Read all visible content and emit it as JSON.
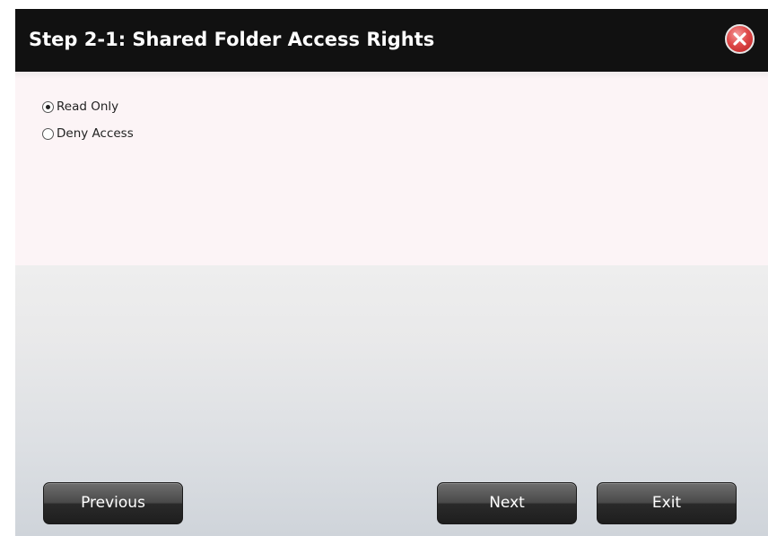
{
  "dialog": {
    "title": "Step 2-1: Shared Folder Access Rights",
    "close_icon": "close-icon"
  },
  "access_options": [
    {
      "label": "Read Only",
      "checked": true
    },
    {
      "label": "Deny Access",
      "checked": false
    }
  ],
  "buttons": {
    "previous": "Previous",
    "next": "Next",
    "exit": "Exit"
  },
  "colors": {
    "titlebar": "#111111",
    "content_bg": "#fcf4f6",
    "close_red": "#df4a4a",
    "button_dark": "#2a2a2a"
  }
}
